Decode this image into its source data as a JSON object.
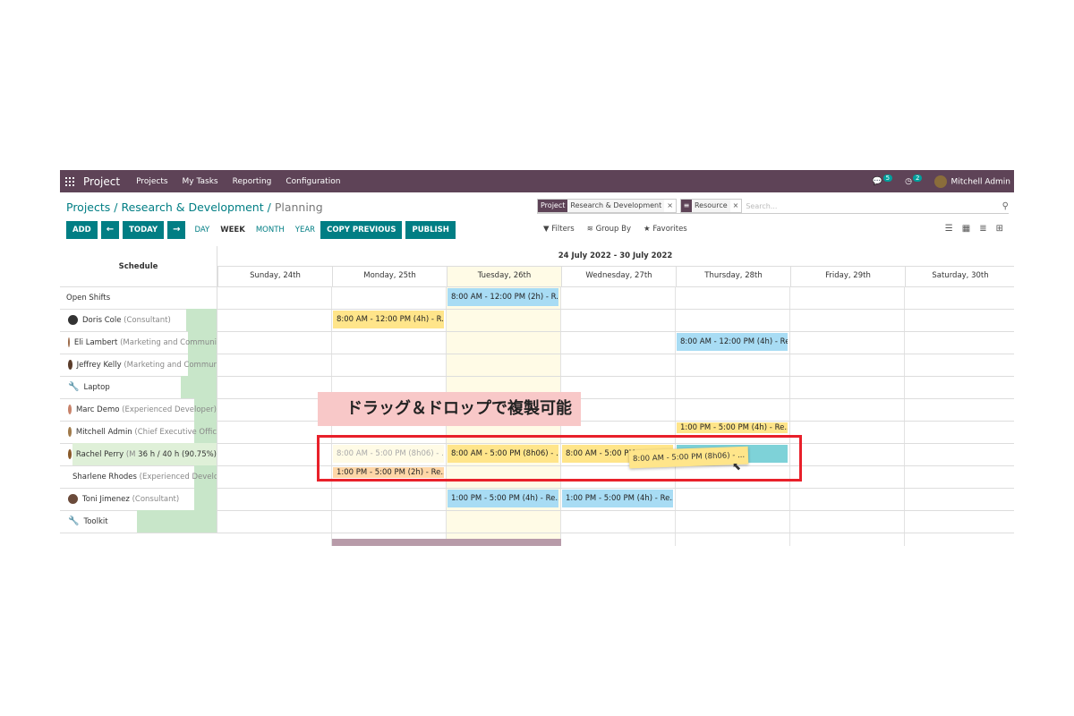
{
  "navbar": {
    "brand": "Project",
    "menu": [
      "Projects",
      "My Tasks",
      "Reporting",
      "Configuration"
    ],
    "messages_count": "5",
    "activities_count": "2",
    "user": "Mitchell Admin"
  },
  "breadcrumb": {
    "projects": "Projects",
    "project": "Research & Development",
    "current": "Planning"
  },
  "search": {
    "facet1_label": "Project",
    "facet1_value": "Research & Development",
    "facet2_value": "Resource",
    "placeholder": "Search..."
  },
  "toolbar": {
    "add": "ADD",
    "today": "TODAY",
    "day": "DAY",
    "week": "WEEK",
    "month": "MONTH",
    "year": "YEAR",
    "copy_previous": "COPY PREVIOUS",
    "publish": "PUBLISH",
    "filters": "Filters",
    "group_by": "Group By",
    "favorites": "Favorites"
  },
  "gantt": {
    "schedule_label": "Schedule",
    "range": "24 July 2022 - 30 July 2022",
    "days": [
      "Sunday, 24th",
      "Monday, 25th",
      "Tuesday, 26th",
      "Wednesday, 27th",
      "Thursday, 28th",
      "Friday, 29th",
      "Saturday, 30th"
    ],
    "rows": [
      {
        "name": "Open Shifts",
        "role": ""
      },
      {
        "name": "Doris Cole",
        "role": "(Consultant)"
      },
      {
        "name": "Eli Lambert",
        "role": "(Marketing and Communi"
      },
      {
        "name": "Jeffrey Kelly",
        "role": "(Marketing and Commur"
      },
      {
        "name": "Laptop",
        "role": ""
      },
      {
        "name": "Marc Demo",
        "role": "(Experienced Developer)"
      },
      {
        "name": "Mitchell Admin",
        "role": "(Chief Executive Offic"
      },
      {
        "name": "Rachel Perry",
        "role": "(M",
        "extra": "36 h / 40 h (90.75%)"
      },
      {
        "name": "Sharlene Rhodes",
        "role": "(Experienced Develc"
      },
      {
        "name": "Toni Jimenez",
        "role": "(Consultant)"
      },
      {
        "name": "Toolkit",
        "role": ""
      }
    ],
    "shifts": {
      "open_tue": "8:00 AM - 12:00 PM (2h) - R...",
      "doris_mon": "8:00 AM - 12:00 PM (4h) - R...",
      "eli_thu": "8:00 AM - 12:00 PM (4h) - Re...",
      "mitchell_thu": "1:00 PM - 5:00 PM (4h) - Re...",
      "rachel_mon": "8:00 AM - 5:00 PM (8h06) - ...",
      "rachel_tue": "8:00 AM - 5:00 PM (8h06) - ...",
      "rachel_wed": "8:00 AM - 5:00 PM",
      "rachel_drag": "8:00 AM - 5:00 PM (8h06) - ...",
      "sharlene_mon": "1:00 PM - 5:00 PM (2h) - Re...",
      "toni_tue": "1:00 PM - 5:00 PM (4h) - Re...",
      "toni_wed": "1:00 PM - 5:00 PM (4h) - Re..."
    }
  },
  "annotation": {
    "callout": "ドラッグ＆ドロップで複製可能"
  },
  "colors": {
    "navbar": "#5e4357",
    "accent": "#017e84",
    "highlight": "#e8202a"
  }
}
